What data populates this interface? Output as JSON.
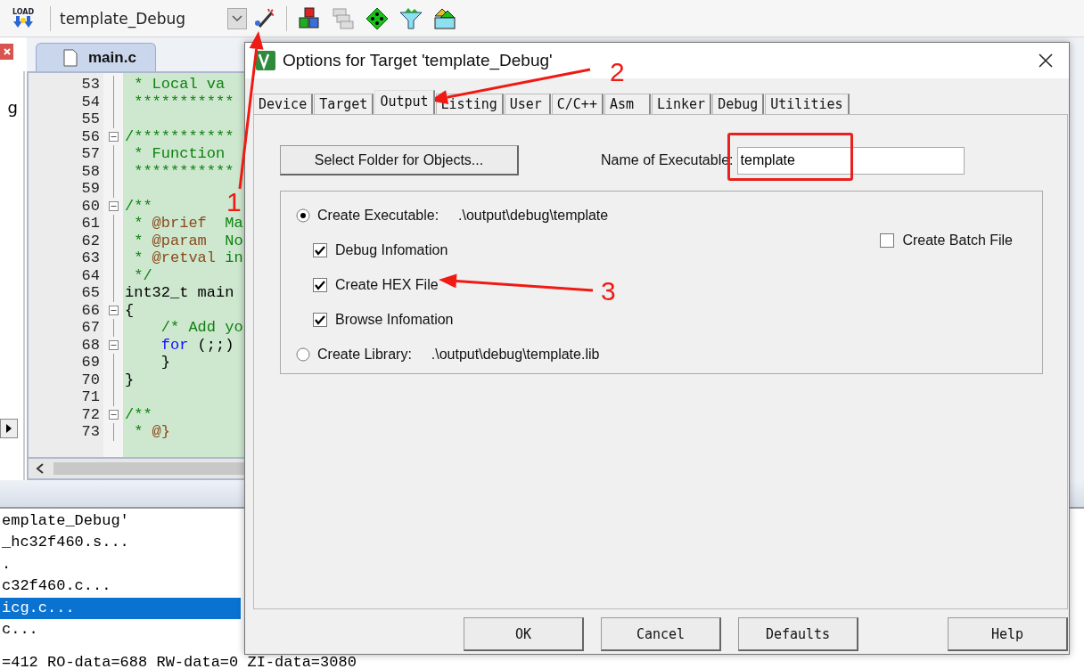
{
  "toolbar": {
    "load_label": "LOAD",
    "target": "template_Debug"
  },
  "side_panel": {
    "text": "g"
  },
  "editor": {
    "tab": "main.c",
    "lines": [
      {
        "number": "53",
        "fold": false,
        "segments": [
          {
            "kind": "comment",
            "text": " * Local va"
          }
        ]
      },
      {
        "number": "54",
        "fold": false,
        "segments": [
          {
            "kind": "comment",
            "text": " ***********"
          }
        ]
      },
      {
        "number": "55",
        "fold": false
      },
      {
        "number": "56",
        "fold": true,
        "segments": [
          {
            "kind": "comment",
            "text": "/***********"
          }
        ]
      },
      {
        "number": "57",
        "fold": false,
        "segments": [
          {
            "kind": "comment",
            "text": " * Function"
          }
        ]
      },
      {
        "number": "58",
        "fold": false,
        "segments": [
          {
            "kind": "comment",
            "text": " ***********"
          }
        ]
      },
      {
        "number": "59",
        "fold": false
      },
      {
        "number": "60",
        "fold": true,
        "segments": [
          {
            "kind": "comment",
            "text": "/**"
          }
        ]
      },
      {
        "number": "61",
        "fold": false,
        "segments": [
          {
            "kind": "comment",
            "text": " * "
          },
          {
            "kind": "tag",
            "text": "@brief"
          },
          {
            "kind": "comment",
            "text": "  Ma"
          }
        ]
      },
      {
        "number": "62",
        "fold": false,
        "segments": [
          {
            "kind": "comment",
            "text": " * "
          },
          {
            "kind": "tag",
            "text": "@param"
          },
          {
            "kind": "comment",
            "text": "  No"
          }
        ]
      },
      {
        "number": "63",
        "fold": false,
        "segments": [
          {
            "kind": "comment",
            "text": " * "
          },
          {
            "kind": "tag",
            "text": "@retval"
          },
          {
            "kind": "comment",
            "text": " in"
          }
        ]
      },
      {
        "number": "64",
        "fold": false,
        "segments": [
          {
            "kind": "comment",
            "text": " */"
          }
        ]
      },
      {
        "number": "65",
        "fold": false,
        "segments": [
          {
            "kind": "plain",
            "text": "int32_t main"
          }
        ]
      },
      {
        "number": "66",
        "fold": true,
        "segments": [
          {
            "kind": "plain",
            "text": "{"
          }
        ]
      },
      {
        "number": "67",
        "fold": false,
        "segments": [
          {
            "kind": "comment",
            "text": "    /* Add yo"
          }
        ]
      },
      {
        "number": "68",
        "fold": true,
        "segments": [
          {
            "kind": "keyword",
            "text": "    for"
          },
          {
            "kind": "plain",
            "text": " (;;)"
          }
        ]
      },
      {
        "number": "69",
        "fold": false,
        "segments": [
          {
            "kind": "plain",
            "text": "    }"
          }
        ]
      },
      {
        "number": "70",
        "fold": false,
        "segments": [
          {
            "kind": "plain",
            "text": "}"
          }
        ]
      },
      {
        "number": "71",
        "fold": false
      },
      {
        "number": "72",
        "fold": true,
        "segments": [
          {
            "kind": "comment",
            "text": "/**"
          }
        ]
      },
      {
        "number": "73",
        "fold": false,
        "segments": [
          {
            "kind": "comment",
            "text": " * "
          },
          {
            "kind": "tag",
            "text": "@}"
          }
        ]
      }
    ]
  },
  "output": {
    "lines": [
      {
        "text": "emplate_Debug'",
        "selected": false
      },
      {
        "text": "_hc32f460.s...",
        "selected": false
      },
      {
        "text": ".",
        "selected": false
      },
      {
        "text": "c32f460.c...",
        "selected": false
      },
      {
        "text": "icg.c...",
        "selected": true
      },
      {
        "text": "c...",
        "selected": false
      },
      {
        "text": "=412 RO-data=688 RW-data=0 ZI-data=3080",
        "selected": false
      }
    ]
  },
  "dialog": {
    "title": "Options for Target 'template_Debug'",
    "tabs": [
      {
        "label": "Device",
        "selected": false
      },
      {
        "label": "Target",
        "selected": false
      },
      {
        "label": "Output",
        "selected": true
      },
      {
        "label": "Listing",
        "selected": false
      },
      {
        "label": "User",
        "selected": false
      },
      {
        "label": "C/C++",
        "selected": false
      },
      {
        "label": "Asm",
        "selected": false
      },
      {
        "label": "Linker",
        "selected": false
      },
      {
        "label": "Debug",
        "selected": false
      },
      {
        "label": "Utilities",
        "selected": false
      }
    ],
    "folder_button": "Select Folder for Objects...",
    "name_label": "Name of Executable:",
    "name_value": "template",
    "name_highlighted": true,
    "create_executable": {
      "label": "Create Executable:",
      "path": ".\\output\\debug\\template",
      "selected": true
    },
    "options": [
      {
        "label": "Debug Infomation",
        "checked": true
      },
      {
        "label": "Create HEX File",
        "checked": true
      },
      {
        "label": "Browse Infomation",
        "checked": true
      }
    ],
    "batch": {
      "label": "Create Batch File",
      "checked": false
    },
    "create_library": {
      "label": "Create Library:",
      "path": ".\\output\\debug\\template.lib",
      "selected": false
    },
    "buttons": [
      "OK",
      "Cancel",
      "Defaults",
      "Help"
    ]
  },
  "annotations": [
    {
      "label": "1"
    },
    {
      "label": "2"
    },
    {
      "label": "3"
    }
  ]
}
